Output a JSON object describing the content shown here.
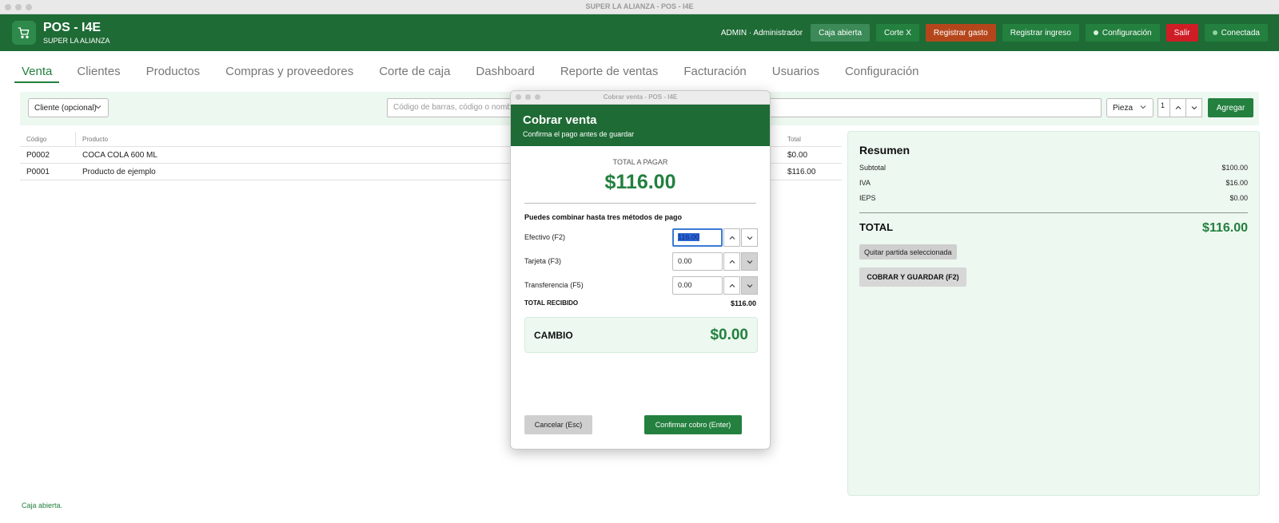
{
  "window": {
    "title": "SUPER LA ALIANZA - POS - I4E"
  },
  "header": {
    "app_title": "POS - I4E",
    "store_name": "SUPER LA ALIANZA",
    "user": "ADMIN · Administrador",
    "buttons": {
      "caja_abierta": "Caja abierta",
      "corte_x": "Corte X",
      "registrar_gasto": "Registrar gasto",
      "registrar_ingreso": "Registrar ingreso",
      "configuracion": "Configuración",
      "salir": "Salir",
      "conectada": "Conectada"
    },
    "icons": {
      "logo": "shopping-cart-icon"
    }
  },
  "tabs": [
    "Venta",
    "Clientes",
    "Productos",
    "Compras y proveedores",
    "Corte de caja",
    "Dashboard",
    "Reporte de ventas",
    "Facturación",
    "Usuarios",
    "Configuración"
  ],
  "active_tab": "Venta",
  "toolbar": {
    "client_select": "Cliente (opcional)",
    "search_placeholder": "Código de barras, código o nombre",
    "unit_select": "Pieza",
    "quantity": "1",
    "add_button": "Agregar"
  },
  "table": {
    "columns": [
      "Código",
      "Producto",
      "Total"
    ],
    "rows": [
      {
        "code": "P0002",
        "product": "COCA COLA 600 ML",
        "total": "$0.00"
      },
      {
        "code": "P0001",
        "product": "Producto de ejemplo",
        "total": "$116.00"
      }
    ]
  },
  "summary": {
    "title": "Resumen",
    "subtotal_label": "Subtotal",
    "subtotal": "$100.00",
    "iva_label": "IVA",
    "iva": "$16.00",
    "ieps_label": "IEPS",
    "ieps": "$0.00",
    "total_label": "TOTAL",
    "total": "$116.00",
    "remove_button": "Quitar partida seleccionada",
    "charge_button": "COBRAR Y GUARDAR (F2)"
  },
  "status": "Caja abierta.",
  "modal": {
    "window_title": "Cobrar venta - POS - I4E",
    "title": "Cobrar venta",
    "subtitle": "Confirma el pago antes de guardar",
    "total_label": "TOTAL A PAGAR",
    "total": "$116.00",
    "hint": "Puedes combinar hasta tres métodos de pago",
    "payments": [
      {
        "label": "Efectivo (F2)",
        "value": "116.00"
      },
      {
        "label": "Tarjeta (F3)",
        "value": "0.00"
      },
      {
        "label": "Transferencia (F5)",
        "value": "0.00"
      }
    ],
    "received_label": "TOTAL RECIBIDO",
    "received": "$116.00",
    "change_label": "CAMBIO",
    "change": "$0.00",
    "cancel_button": "Cancelar (Esc)",
    "confirm_button": "Confirmar cobro (Enter)"
  },
  "colors": {
    "brand_green": "#1e6b35",
    "accent_green": "#23803f",
    "danger": "#cf1d26",
    "warning": "#b5461b"
  }
}
